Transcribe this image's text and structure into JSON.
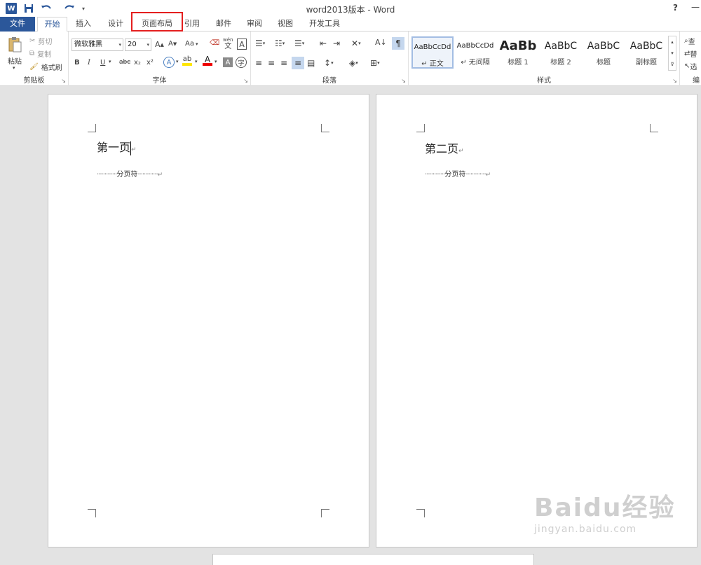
{
  "title_bar": {
    "app_title": "word2013版本 - Word",
    "help": "?"
  },
  "tabs": [
    {
      "label": "文件"
    },
    {
      "label": "开始"
    },
    {
      "label": "插入"
    },
    {
      "label": "设计"
    },
    {
      "label": "页面布局"
    },
    {
      "label": "引用"
    },
    {
      "label": "邮件"
    },
    {
      "label": "审阅"
    },
    {
      "label": "视图"
    },
    {
      "label": "开发工具"
    }
  ],
  "ribbon": {
    "clipboard": {
      "label": "剪贴板",
      "paste": "粘贴",
      "cut": "剪切",
      "copy": "复制",
      "format_painter": "格式刷"
    },
    "font": {
      "label": "字体",
      "font_name": "微软雅黑",
      "font_size": "20",
      "change_case": "Aa",
      "phonetic": "wén",
      "phonetic_char": "文",
      "bold": "B",
      "italic": "I",
      "underline": "U",
      "strikethrough": "abc",
      "subscript": "x₂",
      "superscript": "x²"
    },
    "paragraph": {
      "label": "段落"
    },
    "styles": {
      "label": "样式",
      "items": [
        {
          "sample": "AaBbCcDd",
          "name": "↵ 正文"
        },
        {
          "sample": "AaBbCcDd",
          "name": "↵ 无间隔"
        },
        {
          "sample": "AaBb",
          "name": "标题 1"
        },
        {
          "sample": "AaBbC",
          "name": "标题 2"
        },
        {
          "sample": "AaBbC",
          "name": "标题"
        },
        {
          "sample": "AaBbC",
          "name": "副标题"
        }
      ]
    },
    "editing": {
      "label": "编",
      "find": "查",
      "replace": "替",
      "select": "选"
    }
  },
  "document": {
    "page1": {
      "heading": "第一页",
      "page_break": "分页符"
    },
    "page2": {
      "heading": "第二页",
      "page_break": "分页符"
    }
  },
  "watermark": {
    "main": "Baidu经验",
    "sub": "jingyan.baidu.com"
  },
  "colors": {
    "accent": "#2b579a",
    "highlight_box": "#e41f1f"
  }
}
